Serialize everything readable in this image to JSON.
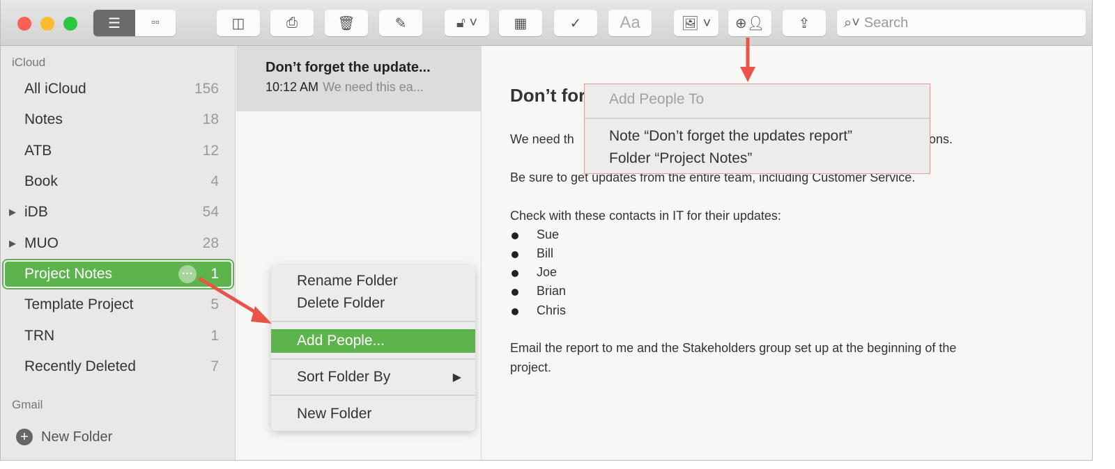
{
  "toolbar": {
    "search_placeholder": "Search",
    "font_label": "Aa"
  },
  "sidebar": {
    "sections": [
      {
        "label": "iCloud"
      },
      {
        "label": "Gmail"
      }
    ],
    "items": [
      {
        "label": "All iCloud",
        "count": "156"
      },
      {
        "label": "Notes",
        "count": "18"
      },
      {
        "label": "ATB",
        "count": "12"
      },
      {
        "label": "Book",
        "count": "4"
      },
      {
        "label": "iDB",
        "count": "54",
        "expandable": true
      },
      {
        "label": "MUO",
        "count": "28",
        "expandable": true
      },
      {
        "label": "Project Notes",
        "count": "1",
        "selected": true
      },
      {
        "label": "Template Project",
        "count": "5"
      },
      {
        "label": "TRN",
        "count": "1"
      },
      {
        "label": "Recently Deleted",
        "count": "7"
      }
    ],
    "new_folder": "New Folder"
  },
  "note_list": {
    "items": [
      {
        "title": "Don’t forget the update...",
        "time": "10:12 AM",
        "preview": "We need this ea..."
      }
    ]
  },
  "editor": {
    "title": "Don’t forget the updates report",
    "p1_start": "We need th",
    "p1_end": "ons.",
    "p2": "Be sure to get updates from the entire team, including Customer Service.",
    "p3": "Check with these contacts in IT for their updates:",
    "bullets": [
      "Sue",
      "Bill",
      "Joe",
      "Brian",
      "Chris"
    ],
    "p4_line1": "Email the report to me and the Stakeholders group set up at the beginning of the",
    "p4_line2": "project."
  },
  "context_menu": {
    "items": [
      "Rename Folder",
      "Delete Folder",
      "Add People...",
      "Sort Folder By",
      "New Folder"
    ],
    "highlighted": "Add People..."
  },
  "add_people_menu": {
    "header": "Add People To",
    "items": [
      "Note “Don’t forget the updates report”",
      "Folder “Project Notes”"
    ]
  },
  "colors": {
    "accent": "#5db34c",
    "annotation_arrow": "#e8534a"
  }
}
